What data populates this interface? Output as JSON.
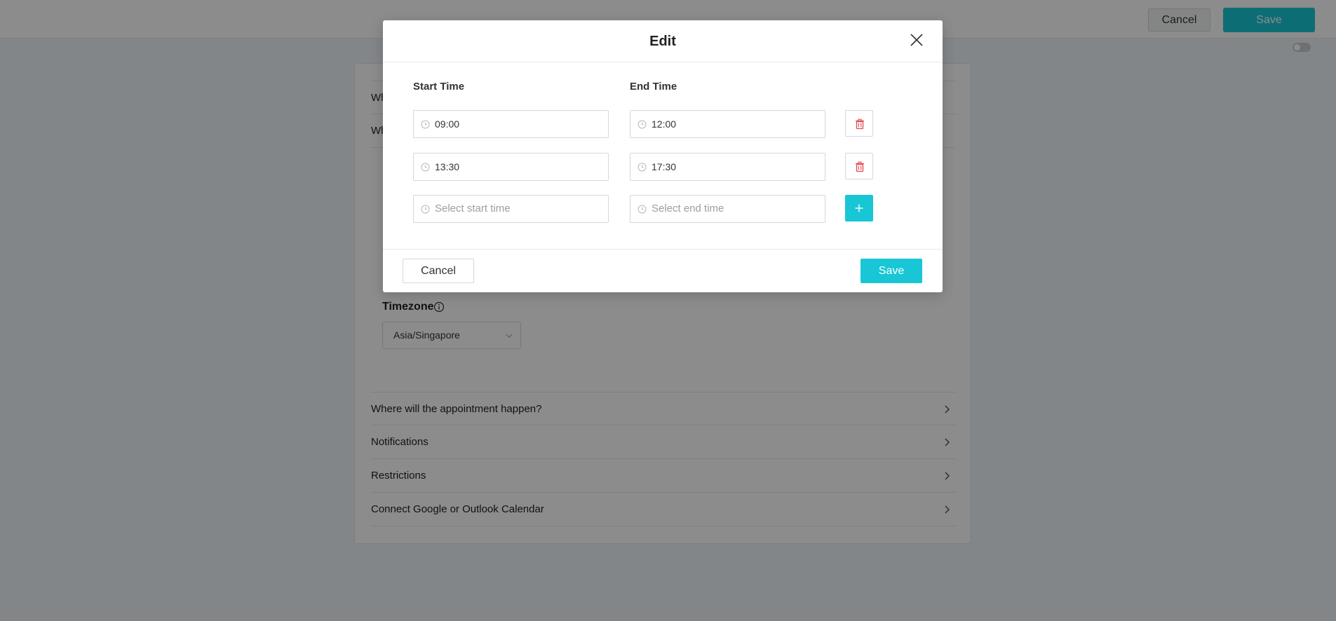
{
  "top_bar": {
    "cancel_label": "Cancel",
    "save_label": "Save"
  },
  "card": {
    "rows_top": [
      {
        "label": "Wh"
      },
      {
        "label": "Wh"
      }
    ],
    "timezone": {
      "label": "Timezone",
      "value": "Asia/Singapore"
    },
    "rows_bottom": [
      {
        "label": "Where will the appointment happen?"
      },
      {
        "label": "Notifications"
      },
      {
        "label": "Restrictions"
      },
      {
        "label": "Connect Google or Outlook Calendar"
      }
    ]
  },
  "modal": {
    "title": "Edit",
    "start_col_label": "Start Time",
    "end_col_label": "End Time",
    "time_ranges": [
      {
        "start": "09:00",
        "end": "12:00"
      },
      {
        "start": "13:30",
        "end": "17:30"
      }
    ],
    "new_start_placeholder": "Select start time",
    "new_end_placeholder": "Select end time",
    "cancel_label": "Cancel",
    "save_label": "Save"
  },
  "colors": {
    "accent": "#18c6d6",
    "danger": "#e4494f"
  },
  "icons": {
    "close": "close-icon",
    "clock": "clock-icon",
    "delete": "trash-icon",
    "add": "plus-icon",
    "chevron": "chevron-right-icon",
    "info": "info-icon"
  }
}
